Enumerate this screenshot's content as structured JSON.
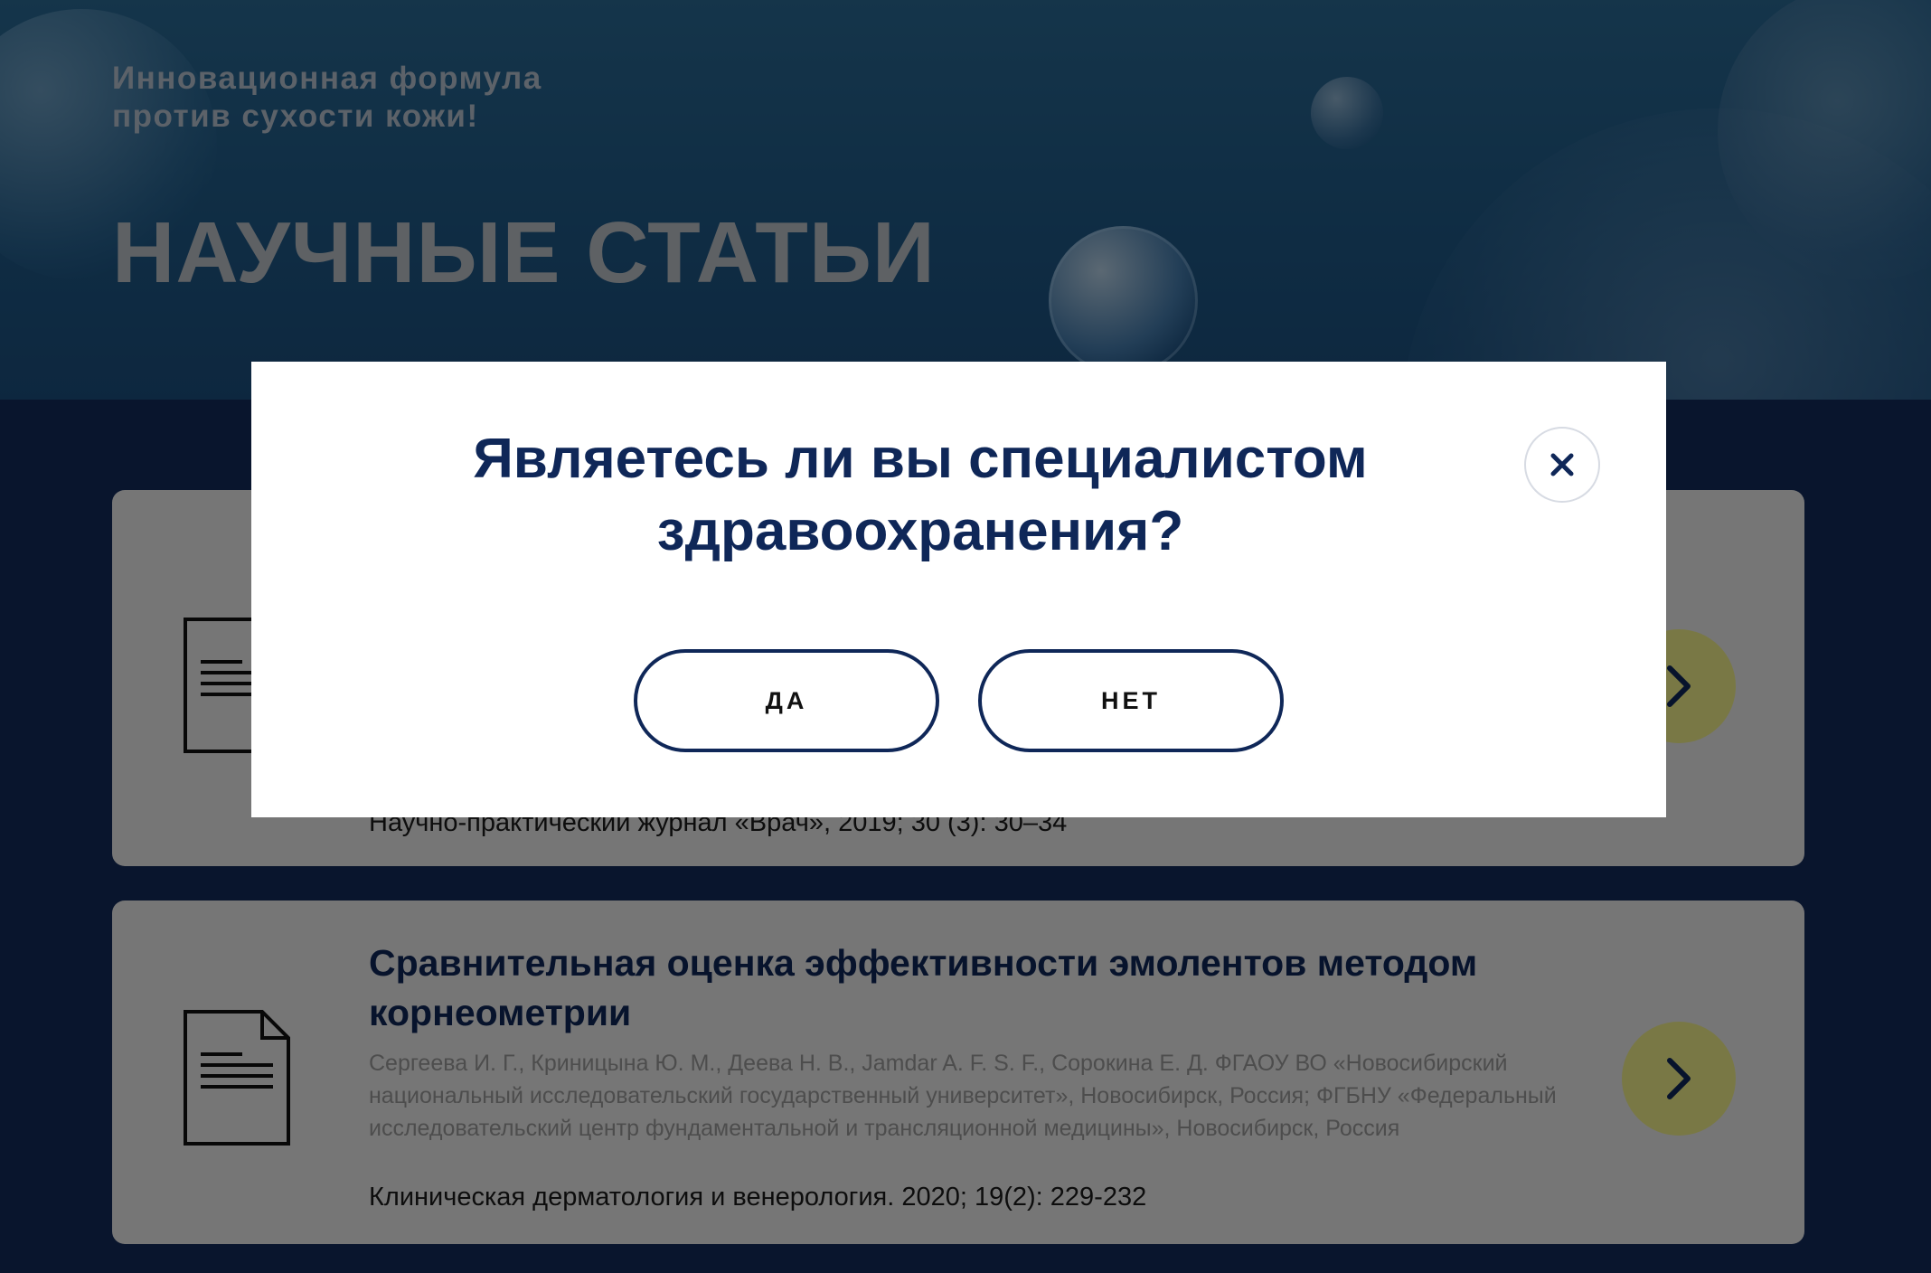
{
  "hero": {
    "subtitle_line1": "Инновационная формула",
    "subtitle_line2": "против сухости кожи!",
    "title": "НАУЧНЫЕ СТАТЬИ"
  },
  "articles": [
    {
      "title": "",
      "authors": "",
      "journal": "Научно-практический журнал «Врач», 2019; 30 (3): 30–34",
      "icon": "document-icon",
      "button_icon": "chevron-right-icon"
    },
    {
      "title": "Сравнительная оценка эффективности эмолентов методом корнеометрии",
      "authors": "Сергеева И. Г., Криницына Ю. М., Деева Н. В., Jamdar A. F. S. F., Сорокина Е. Д. ФГАОУ ВО «Новосибирский национальный исследовательский государственный университет», Новосибирск, Россия; ФГБНУ «Федеральный исследовательский центр фундаментальной и трансляционной медицины», Новосибирск, Россия",
      "journal": "Клиническая дерматология и венерология. 2020; 19(2): 229-232",
      "icon": "document-icon",
      "button_icon": "chevron-right-icon"
    }
  ],
  "modal": {
    "question": "Являетесь ли вы специалистом здравоохранения?",
    "yes_label": "ДА",
    "no_label": "НЕТ",
    "close_icon": "close-icon"
  },
  "colors": {
    "brand_navy": "#0f2758",
    "accent_yellow": "#f3f18a",
    "hero_blue": "#1f5a88",
    "card_bg": "#ececec"
  }
}
